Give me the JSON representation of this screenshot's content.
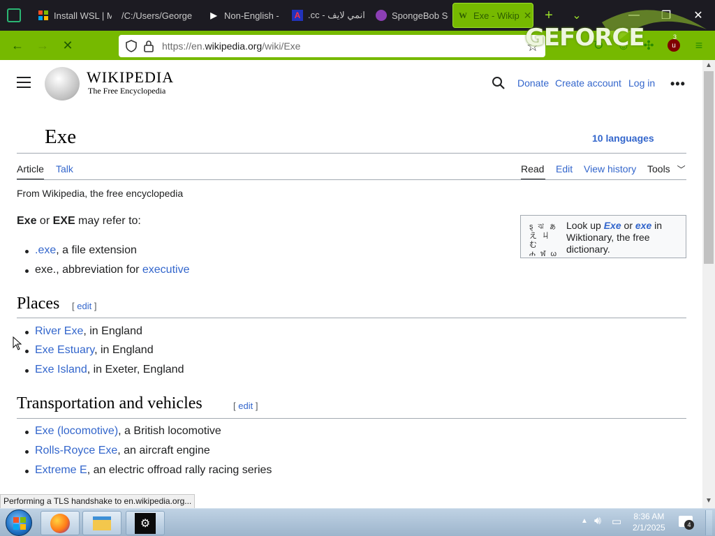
{
  "browser": {
    "tabs": [
      {
        "title": "Install WSL | M",
        "icon": "microsoft-icon"
      },
      {
        "title": "/C:/Users/George",
        "icon": "file-icon"
      },
      {
        "title": "Non-English -",
        "icon": "play-icon"
      },
      {
        "title": ".cc - انمي لايف",
        "icon": "a-icon"
      },
      {
        "title": "SpongeBob Sq",
        "icon": "tor-icon"
      },
      {
        "title": "Exe - Wikip",
        "icon": "wikipedia-icon",
        "active": true
      }
    ],
    "url_prefix": "https://en.",
    "url_domain": "wikipedia.org",
    "url_path": "/wiki/Exe",
    "overlay_text": "GEFORCE",
    "accent_color": "#76b900",
    "extension_badge": "3"
  },
  "wiki": {
    "logo_title": "WIKIPEDIA",
    "logo_subtitle": "The Free Encyclopedia",
    "header_links": {
      "donate": "Donate",
      "create_account": "Create account",
      "login": "Log in"
    },
    "page_title": "Exe",
    "languages": "10 languages",
    "tabs_left": [
      "Article",
      "Talk"
    ],
    "tabs_right": [
      "Read",
      "Edit",
      "View history",
      "Tools"
    ],
    "tagline": "From Wikipedia, the free encyclopedia",
    "intro": {
      "b1": "Exe",
      "or": " or ",
      "b2": "EXE",
      "rest": " may refer to:"
    },
    "intro_items": [
      {
        "link": ".exe",
        "text": ", a file extension"
      },
      {
        "pre": "exe., abbreviation for ",
        "link": "executive"
      }
    ],
    "wiktionary": {
      "pre": "Look up ",
      "term1": "Exe",
      "mid": " or ",
      "term2": "exe",
      "post": " in Wiktionary, the free dictionary."
    },
    "sections": [
      {
        "title": "Places",
        "edit": "edit",
        "items": [
          {
            "link": "River Exe",
            "text": ", in England"
          },
          {
            "link": "Exe Estuary",
            "text": ", in England"
          },
          {
            "link": "Exe Island",
            "text": ", in Exeter, England"
          }
        ]
      },
      {
        "title": "Transportation and vehicles",
        "edit": "edit",
        "items": [
          {
            "link": "Exe (locomotive)",
            "text": ", a British locomotive"
          },
          {
            "link": "Rolls-Royce Exe",
            "text": ", an aircraft engine"
          },
          {
            "link": "Extreme E",
            "text": ", an electric offroad rally racing series"
          }
        ]
      }
    ]
  },
  "status_text": "Performing a TLS handshake to en.wikipedia.org...",
  "taskbar": {
    "time": "8:36 AM",
    "date": "2/1/2025",
    "notification_count": "4"
  }
}
